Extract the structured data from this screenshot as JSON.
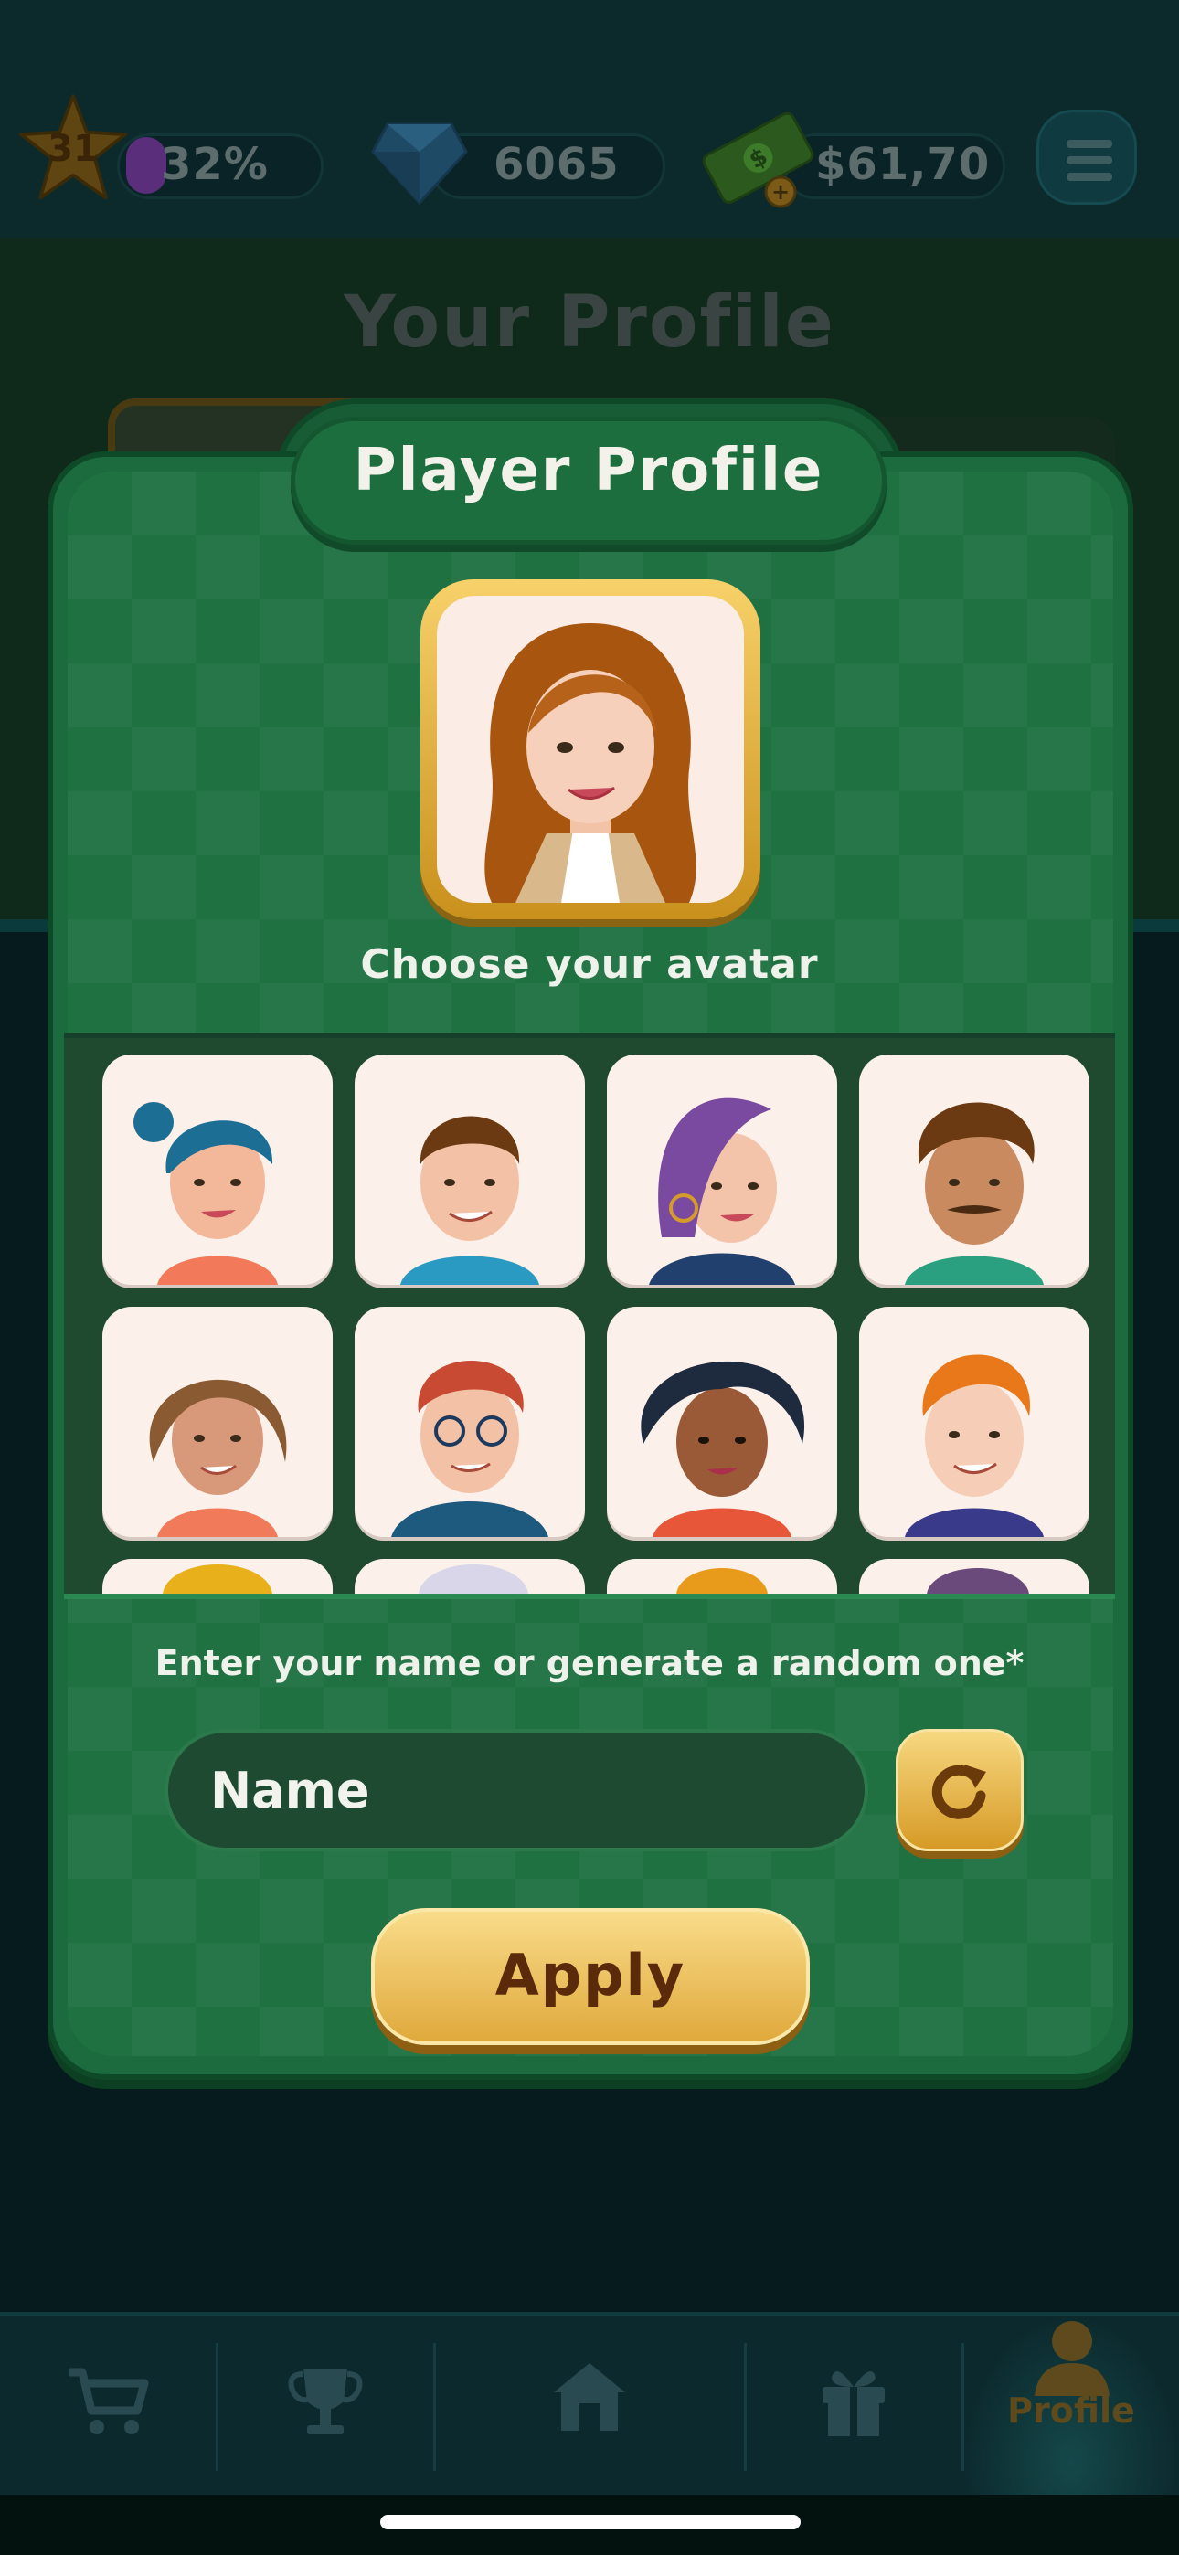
{
  "hud": {
    "level": "31",
    "xp_percent": "32%",
    "gems": "6065",
    "cash": "$61,70"
  },
  "background": {
    "page_title": "Your Profile"
  },
  "modal": {
    "title": "Player Profile",
    "choose_label": "Choose your avatar",
    "name_prompt": "Enter your name or generate a random one*",
    "name_placeholder": "Name",
    "apply_label": "Apply"
  },
  "bottom_nav": {
    "items": [
      {
        "icon": "cart-icon",
        "label": ""
      },
      {
        "icon": "trophy-icon",
        "label": ""
      },
      {
        "icon": "home-icon",
        "label": ""
      },
      {
        "icon": "gift-icon",
        "label": ""
      },
      {
        "icon": "profile-icon",
        "label": "Profile"
      }
    ]
  },
  "colors": {
    "panel_green": "#1f7142",
    "gold": "#e0a93c",
    "dark_bg": "#061b1d"
  }
}
